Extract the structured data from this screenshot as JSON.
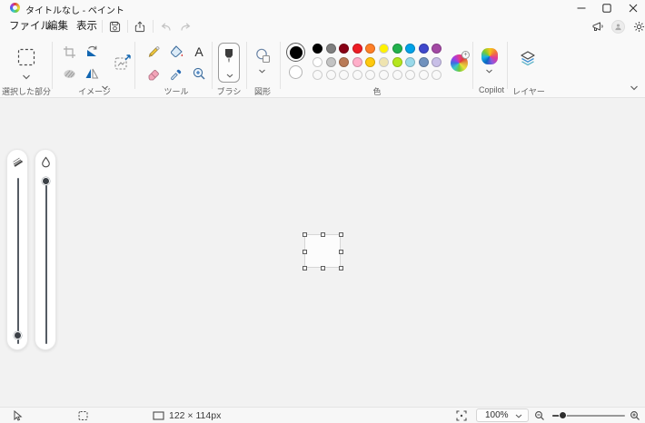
{
  "window": {
    "title": "タイトルなし - ペイント"
  },
  "menu": {
    "file": "ファイル",
    "edit": "編集",
    "view": "表示"
  },
  "ribbon": {
    "selection_label": "選択した部分",
    "image_label": "イメージ",
    "tools_label": "ツール",
    "brush_label": "ブラシ",
    "shapes_label": "図形",
    "colors_label": "色",
    "copilot_label": "Copilot",
    "layers_label": "レイヤー",
    "text_tool_glyph": "A"
  },
  "palette": {
    "color1": "#000000",
    "color2": "#ffffff",
    "row1": [
      "#000000",
      "#7f7f7f",
      "#880015",
      "#ed1c24",
      "#ff7f27",
      "#fff200",
      "#22b14c",
      "#00a2e8",
      "#3f48cc",
      "#a349a4"
    ],
    "row2": [
      "#ffffff",
      "#c3c3c3",
      "#b97a57",
      "#ffaec9",
      "#ffc90e",
      "#efe4b0",
      "#b5e61d",
      "#99d9ea",
      "#7092be",
      "#c8bfe7"
    ],
    "row3": [
      "",
      "",
      "",
      "",
      "",
      "",
      "",
      "",
      "",
      ""
    ],
    "edit_badge": "+"
  },
  "status": {
    "canvas_size": "122 × 114px",
    "zoom": "100%"
  },
  "theme": {
    "accent_blue": "#0a64c0",
    "bar_bg": "#f9f9f9",
    "content_bg": "#f2f2f2"
  }
}
